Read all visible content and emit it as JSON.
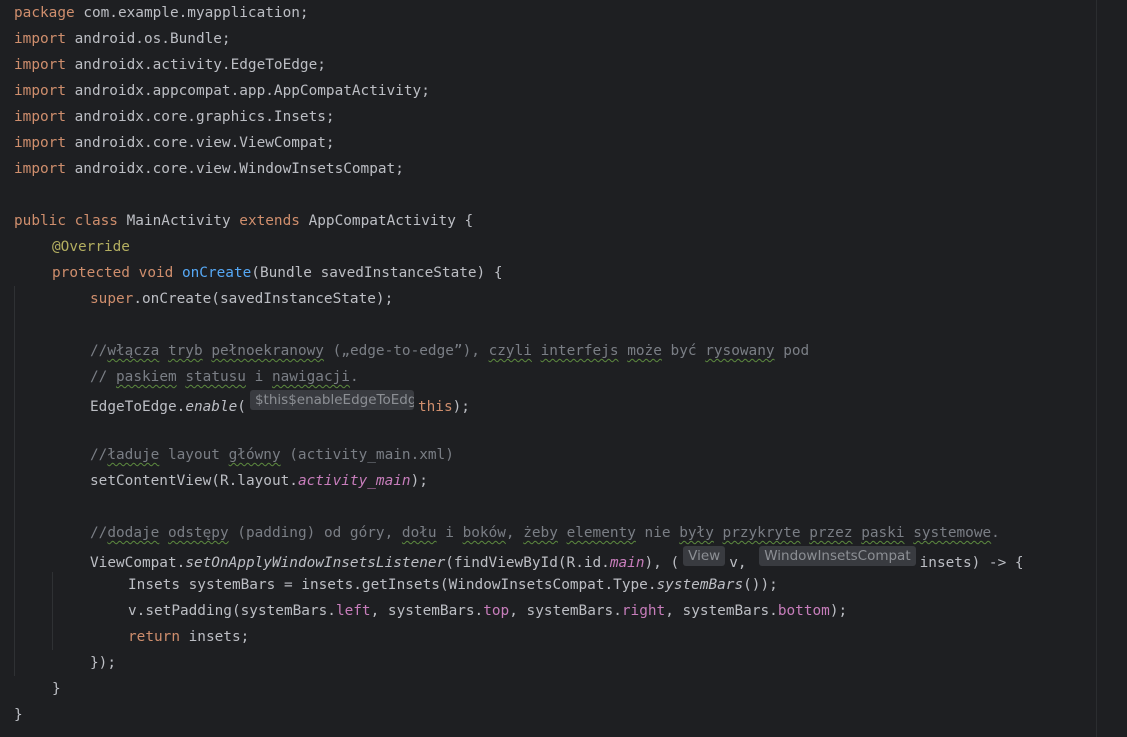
{
  "editor": {
    "lines": {
      "l1": [
        "package",
        " com.example.myapplication;"
      ],
      "l2": [
        "import",
        " android.os.Bundle;"
      ],
      "l3": [
        "import",
        " androidx.activity.EdgeToEdge;"
      ],
      "l4": [
        "import",
        " androidx.appcompat.app.AppCompatActivity;"
      ],
      "l5": [
        "import",
        " androidx.core.graphics.Insets;"
      ],
      "l6": [
        "import",
        " androidx.core.view.ViewCompat;"
      ],
      "l7": [
        "import",
        " androidx.core.view.WindowInsetsCompat;"
      ],
      "l9": [
        "public",
        " ",
        "class",
        " MainActivity ",
        "extends",
        " AppCompatActivity {"
      ],
      "l10": [
        "@Override"
      ],
      "l11": [
        "protected",
        " ",
        "void",
        " ",
        "onCreate",
        "(Bundle savedInstanceState) {"
      ],
      "l12": [
        "super",
        ".onCreate(savedInstanceState);"
      ],
      "l14": [
        "//",
        "włącza",
        " ",
        "tryb",
        " ",
        "pełnoekranowy",
        " („edge-to-edge”), ",
        "czyli",
        " ",
        "interfejs",
        " ",
        "może",
        " być ",
        "rysowany",
        " pod"
      ],
      "l15": [
        "// ",
        "paskiem",
        " ",
        "statusu",
        " i ",
        "nawigacji",
        "."
      ],
      "l16": [
        "EdgeToEdge.",
        "enable",
        "(",
        "$this$enableEdgeToEdge",
        "this",
        ");"
      ],
      "l18": [
        "//",
        "ładuje",
        " layout ",
        "główny",
        " (activity_main.xml)"
      ],
      "l19": [
        "setContentView(R.layout.",
        "activity_main",
        ");"
      ],
      "l21": [
        "//",
        "dodaje",
        " ",
        "odstępy",
        " (padding) od góry, ",
        "dołu",
        " i ",
        "boków",
        ", ",
        "żeby",
        " ",
        "elementy",
        " nie ",
        "były",
        " ",
        "przykryte",
        " ",
        "przez",
        " ",
        "paski",
        " ",
        "systemowe",
        "."
      ],
      "l22": [
        "ViewCompat.",
        "setOnApplyWindowInsetsListener",
        "(findViewById(R.id.",
        "main",
        "), (",
        "View",
        "v, ",
        "WindowInsetsCompat",
        "insets) -> {"
      ],
      "l23": [
        "Insets systemBars = insets.getInsets(WindowInsetsCompat.Type.",
        "systemBars",
        "());"
      ],
      "l24": [
        "v.setPadding(systemBars.",
        "left",
        ", systemBars.",
        "top",
        ", systemBars.",
        "right",
        ", systemBars.",
        "bottom",
        ");"
      ],
      "l25": [
        "return",
        " insets;"
      ],
      "l26": [
        "});"
      ],
      "l27": [
        "}"
      ],
      "l28": [
        "}"
      ]
    }
  },
  "colors": {
    "background": "#1e1f22",
    "text": "#bcbec4",
    "keyword": "#cf8e6d",
    "annotation": "#b3ae60",
    "function": "#56a8f5",
    "comment": "#7a7e85",
    "field": "#c77dbb",
    "inlay_hint_bg": "#393b40"
  }
}
